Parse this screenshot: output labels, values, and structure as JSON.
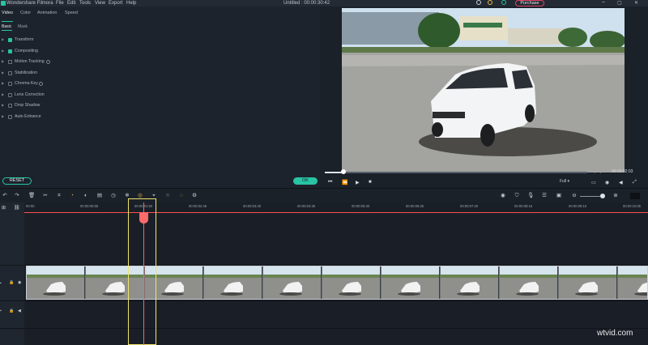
{
  "app": {
    "name": "Wondershare Filmora",
    "project_title": "Untitled : 00:00:30:42"
  },
  "menu": [
    "File",
    "Edit",
    "Tools",
    "View",
    "Export",
    "Help"
  ],
  "purchase_label": "Purchase",
  "panel": {
    "tabs": [
      "Video",
      "Color",
      "Animation",
      "Speed"
    ],
    "active_tab": "Video",
    "subtabs": [
      "Basic",
      "Mask"
    ],
    "active_subtab": "Basic",
    "properties": [
      {
        "label": "Transform",
        "checked": true
      },
      {
        "label": "Compositing",
        "checked": true
      },
      {
        "label": "Motion Tracking",
        "checked": false,
        "help": true
      },
      {
        "label": "Stabilization",
        "checked": false
      },
      {
        "label": "Chroma Key",
        "checked": false,
        "help": true
      },
      {
        "label": "Lens Correction",
        "checked": false
      },
      {
        "label": "Drop Shadow",
        "checked": false
      },
      {
        "label": "Auto Enhance",
        "checked": false
      }
    ],
    "reset_label": "RESET",
    "ok_label": "OK"
  },
  "preview": {
    "timecode": "00:00:02:03",
    "quality": "Full",
    "progress_fraction": 0.07
  },
  "timeline": {
    "ruler_ticks": [
      "00:00",
      "00:00:00:55",
      "00:00:01:50",
      "00:00:02:45",
      "00:00:03:40",
      "00:00:04:35",
      "00:00:05:30",
      "00:00:06:25",
      "00:00:07:20",
      "00:00:08:15",
      "00:00:09:10",
      "00:00:10:05"
    ]
  },
  "accent_color": "#29c4a4",
  "watermark": "wtvid.com"
}
